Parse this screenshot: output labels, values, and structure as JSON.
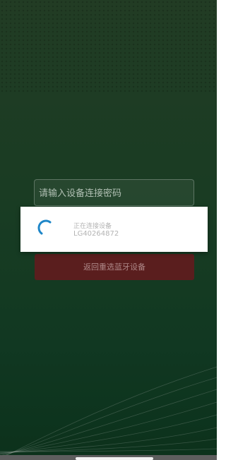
{
  "password_input": {
    "placeholder": "请输入设备连接密码",
    "value": ""
  },
  "back_button": {
    "label": "返回重选蓝牙设备"
  },
  "connecting_dialog": {
    "title": "正在连接设备",
    "device_id": "LG40264872",
    "spinner_color": "#1e86c8"
  },
  "colors": {
    "background_top": "#2a4a2c",
    "background_bottom": "#0f3d22",
    "back_button": "#5a1e1e"
  }
}
